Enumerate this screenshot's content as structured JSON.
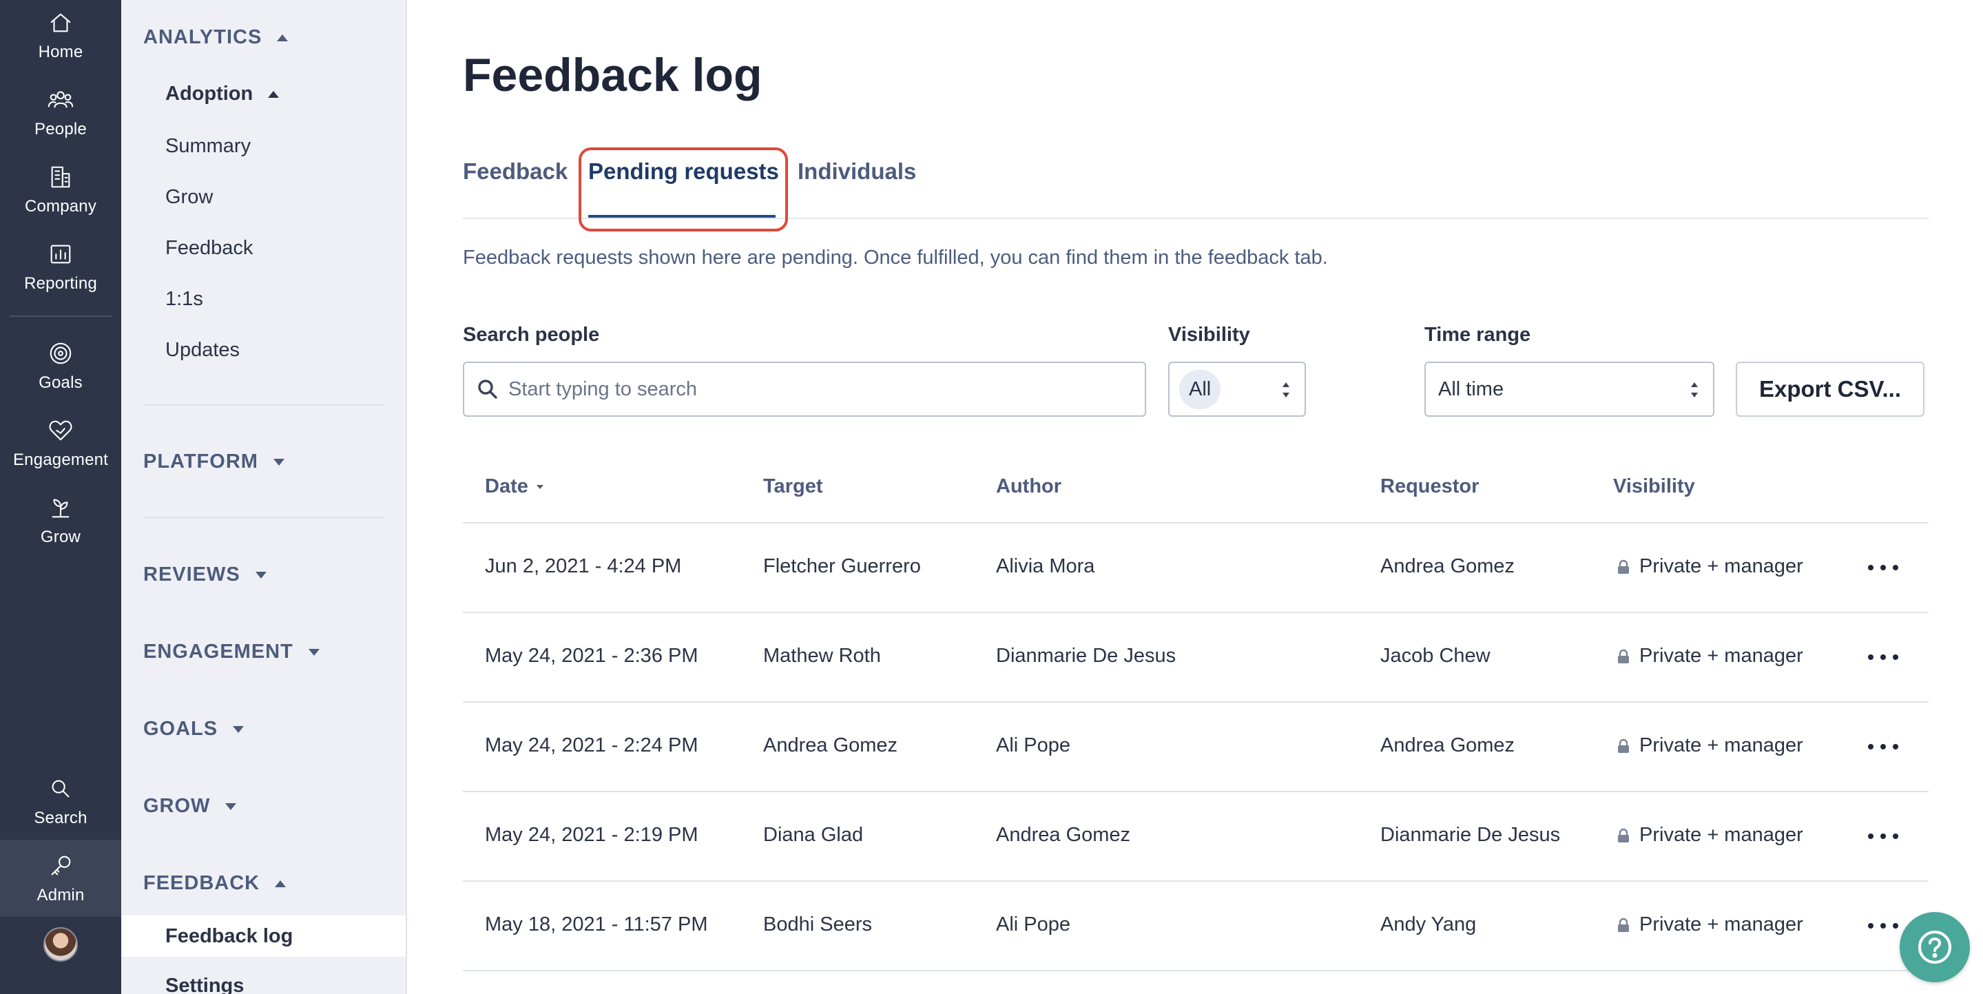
{
  "rail": {
    "home": "Home",
    "people": "People",
    "company": "Company",
    "reporting": "Reporting",
    "goals": "Goals",
    "engagement": "Engagement",
    "grow": "Grow",
    "search": "Search",
    "admin": "Admin"
  },
  "sidebar": {
    "analytics": "ANALYTICS",
    "adoption": "Adoption",
    "adoption_items": [
      "Summary",
      "Grow",
      "Feedback",
      "1:1s",
      "Updates"
    ],
    "platform": "PLATFORM",
    "reviews": "REVIEWS",
    "engagement": "ENGAGEMENT",
    "goals": "GOALS",
    "grow": "GROW",
    "feedback": "FEEDBACK",
    "feedback_items": [
      "Feedback log",
      "Settings"
    ]
  },
  "page": {
    "title": "Feedback log",
    "tabs": [
      "Feedback",
      "Pending requests",
      "Individuals"
    ],
    "active_tab": "Pending requests",
    "info": "Feedback requests shown here are pending. Once fulfilled, you can find them in the feedback tab."
  },
  "filters": {
    "search_label": "Search people",
    "search_placeholder": "Start typing to search",
    "visibility_label": "Visibility",
    "visibility_value": "All",
    "time_label": "Time range",
    "time_value": "All time",
    "export_label": "Export CSV..."
  },
  "table": {
    "columns": [
      "Date",
      "Target",
      "Author",
      "Requestor",
      "Visibility"
    ],
    "rows": [
      {
        "date": "Jun 2, 2021 - 4:24 PM",
        "target": "Fletcher Guerrero",
        "author": "Alivia Mora",
        "requestor": "Andrea Gomez",
        "visibility": "Private + manager"
      },
      {
        "date": "May 24, 2021 - 2:36 PM",
        "target": "Mathew Roth",
        "author": "Dianmarie De Jesus",
        "requestor": "Jacob Chew",
        "visibility": "Private + manager"
      },
      {
        "date": "May 24, 2021 - 2:24 PM",
        "target": "Andrea Gomez",
        "author": "Ali Pope",
        "requestor": "Andrea Gomez",
        "visibility": "Private + manager"
      },
      {
        "date": "May 24, 2021 - 2:19 PM",
        "target": "Diana Glad",
        "author": "Andrea Gomez",
        "requestor": "Dianmarie De Jesus",
        "visibility": "Private + manager"
      },
      {
        "date": "May 18, 2021 - 11:57 PM",
        "target": "Bodhi Seers",
        "author": "Ali Pope",
        "requestor": "Andy Yang",
        "visibility": "Private + manager"
      }
    ]
  },
  "colors": {
    "rail_bg": "#2e3548",
    "sidebar_bg": "#eef0f5",
    "tab_active_underline": "#1f4e8a",
    "tab_highlight_border": "#e0483a",
    "help_button": "#4aa89a"
  },
  "icons": [
    "home-icon",
    "people-icon",
    "company-icon",
    "reporting-icon",
    "goals-icon",
    "engagement-icon",
    "grow-icon",
    "search-icon",
    "admin-key-icon",
    "lock-icon",
    "more-options-icon",
    "help-icon"
  ]
}
